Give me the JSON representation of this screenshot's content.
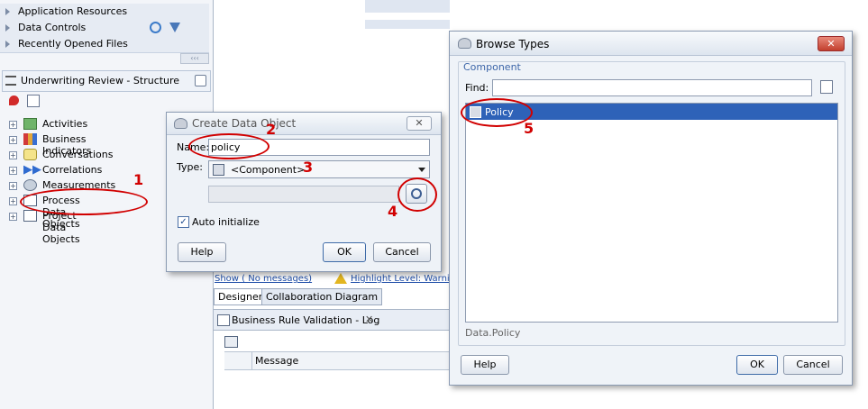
{
  "left_panel": {
    "accordion": [
      "Application Resources",
      "Data Controls",
      "Recently Opened Files"
    ],
    "structure_title": "Underwriting Review - Structure",
    "tree_items": [
      "Activities",
      "Business Indicators",
      "Conversations",
      "Correlations",
      "Measurements",
      "Process Data Objects",
      "Project Data Objects"
    ]
  },
  "create_dialog": {
    "title": "Create Data Object",
    "name_label": "Name:",
    "name_value": "policy",
    "type_label": "Type:",
    "type_value": "<Component>",
    "auto_init_label": "Auto initialize",
    "help": "Help",
    "ok": "OK",
    "cancel": "Cancel"
  },
  "background_editor": {
    "show_link": "Show ( No messages)",
    "highlight_link": "Highlight Level: Warnings",
    "tabs": [
      "Designer",
      "Collaboration Diagram"
    ],
    "log_title": "Business Rule Validation - Log",
    "column_message": "Message"
  },
  "browse_dialog": {
    "title": "Browse Types",
    "section": "Component",
    "find_label": "Find:",
    "find_value": "",
    "results": [
      "Policy"
    ],
    "status": "Data.Policy",
    "help": "Help",
    "ok": "OK",
    "cancel": "Cancel"
  },
  "annotations": [
    "1",
    "2",
    "3",
    "4",
    "5"
  ],
  "colors": {
    "annotation": "#d10000",
    "selection": "#2e62b8"
  }
}
